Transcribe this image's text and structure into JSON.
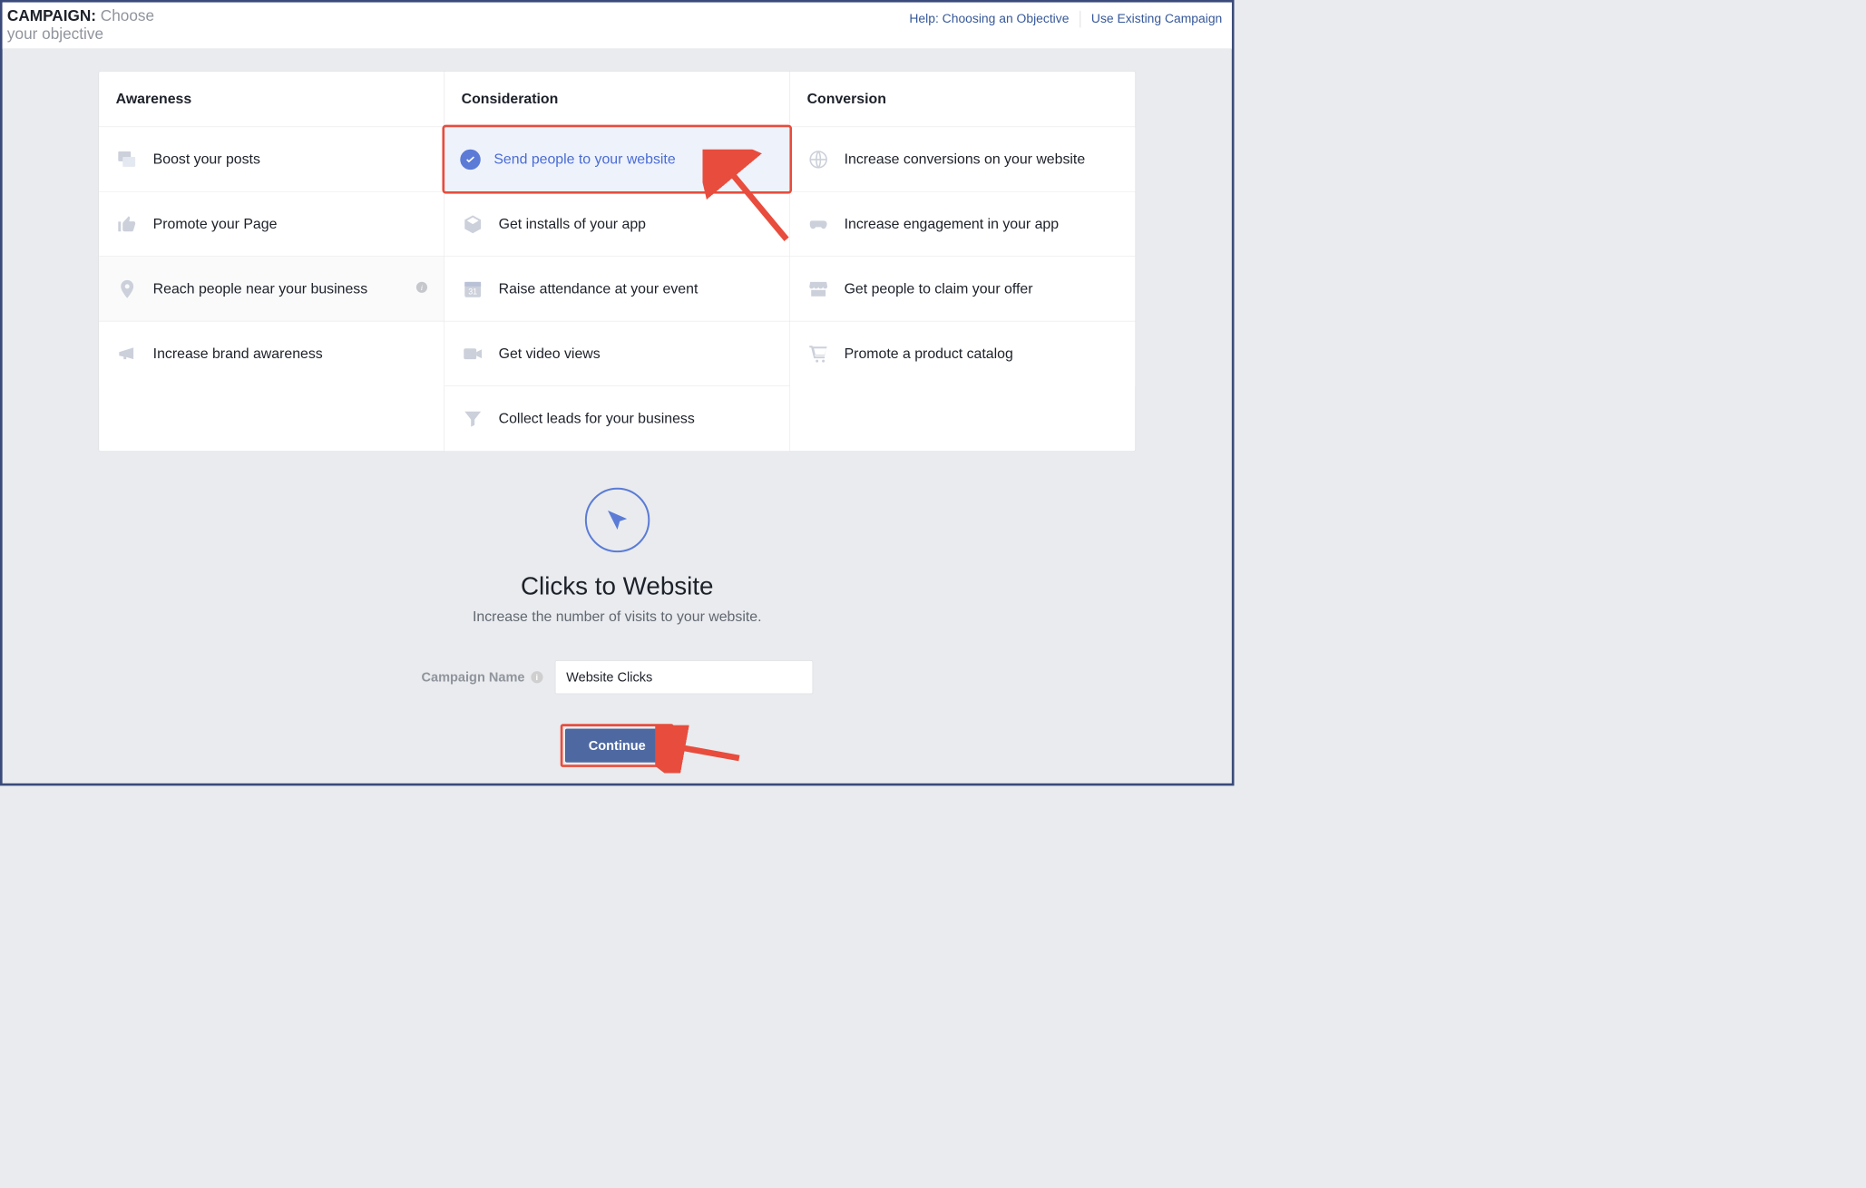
{
  "header": {
    "campaign_label": "CAMPAIGN:",
    "campaign_sub": "Choose your objective",
    "help_link": "Help: Choosing an Objective",
    "existing_link": "Use Existing Campaign"
  },
  "columns": [
    {
      "title": "Awareness",
      "items": [
        {
          "icon": "posts-icon",
          "label": "Boost your posts",
          "selected": false,
          "hover": false,
          "info": false
        },
        {
          "icon": "thumb-up-icon",
          "label": "Promote your Page",
          "selected": false,
          "hover": false,
          "info": false
        },
        {
          "icon": "pin-person-icon",
          "label": "Reach people near your business",
          "selected": false,
          "hover": true,
          "info": true
        },
        {
          "icon": "megaphone-icon",
          "label": "Increase brand awareness",
          "selected": false,
          "hover": false,
          "info": false
        }
      ]
    },
    {
      "title": "Consideration",
      "items": [
        {
          "icon": "check-icon",
          "label": "Send people to your website",
          "selected": true,
          "hover": false,
          "info": false
        },
        {
          "icon": "box-icon",
          "label": "Get installs of your app",
          "selected": false,
          "hover": false,
          "info": false
        },
        {
          "icon": "calendar-icon",
          "label": "Raise attendance at your event",
          "selected": false,
          "hover": false,
          "info": false
        },
        {
          "icon": "video-icon",
          "label": "Get video views",
          "selected": false,
          "hover": false,
          "info": false
        },
        {
          "icon": "funnel-icon",
          "label": "Collect leads for your business",
          "selected": false,
          "hover": false,
          "info": false
        }
      ]
    },
    {
      "title": "Conversion",
      "items": [
        {
          "icon": "globe-icon",
          "label": "Increase conversions on your website",
          "selected": false,
          "hover": false,
          "info": false
        },
        {
          "icon": "gamepad-icon",
          "label": "Increase engagement in your app",
          "selected": false,
          "hover": false,
          "info": false
        },
        {
          "icon": "storefront-icon",
          "label": "Get people to claim your offer",
          "selected": false,
          "hover": false,
          "info": false
        },
        {
          "icon": "cart-icon",
          "label": "Promote a product catalog",
          "selected": false,
          "hover": false,
          "info": false
        }
      ]
    }
  ],
  "detail": {
    "title": "Clicks to Website",
    "subtitle": "Increase the number of visits to your website.",
    "field_label": "Campaign Name",
    "field_value": "Website Clicks",
    "continue_label": "Continue"
  }
}
